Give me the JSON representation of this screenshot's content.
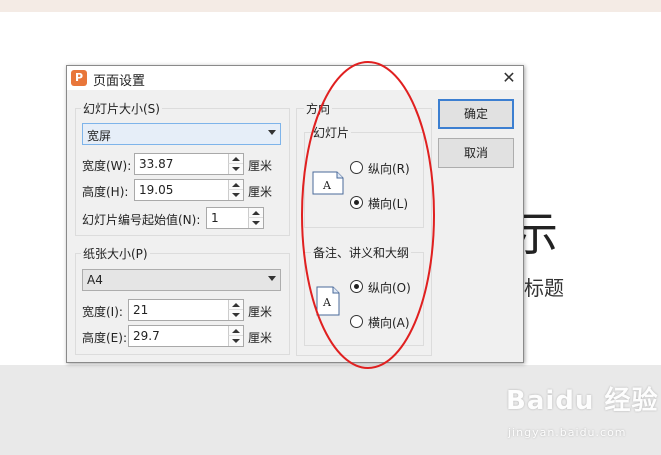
{
  "background_slide": {
    "title": "示",
    "subtitle": "标题",
    "watermark": "Baidu 经验",
    "watermark_url": "jingyan.baidu.com"
  },
  "dialog": {
    "title": "页面设置",
    "app_icon": "P",
    "close": "✕",
    "slide_size": {
      "label": "幻灯片大小(S)",
      "selected": "宽屏",
      "width_label": "宽度(W):",
      "width_value": "33.87",
      "height_label": "高度(H):",
      "height_value": "19.05",
      "unit": "厘米",
      "numbering_label": "幻灯片编号起始值(N):",
      "numbering_value": "1"
    },
    "paper_size": {
      "label": "纸张大小(P)",
      "selected": "A4",
      "width_label": "宽度(I):",
      "width_value": "21",
      "height_label": "高度(E):",
      "height_value": "29.7",
      "unit": "厘米"
    },
    "orientation": {
      "label": "方向",
      "slides": {
        "label": "幻灯片",
        "portrait": "纵向(R)",
        "landscape": "横向(L)",
        "selected": "landscape",
        "icon_letter": "A"
      },
      "notes": {
        "label": "备注、讲义和大纲",
        "portrait": "纵向(O)",
        "landscape": "横向(A)",
        "selected": "portrait",
        "icon_letter": "A"
      }
    },
    "ok": "确定",
    "cancel": "取消"
  },
  "colors": {
    "annotation_ellipse": "#e02020",
    "default_button_border": "#3c7fd1",
    "app_icon": "#e8763a"
  }
}
